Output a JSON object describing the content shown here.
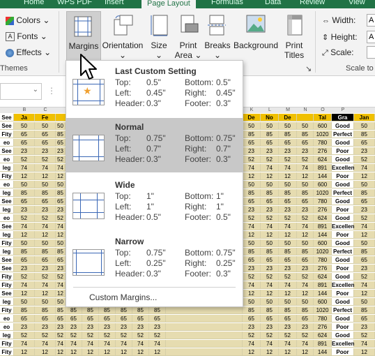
{
  "tabs": [
    "Home",
    "WPS PDF",
    "Insert",
    "Page Layout",
    "Formulas",
    "Data",
    "Review",
    "View"
  ],
  "ribbon": {
    "themes": {
      "colors": "Colors",
      "fonts": "Fonts",
      "effects": "Effects",
      "group_label": "Themes"
    },
    "margins": "Margins",
    "orientation": "Orientation",
    "size": "Size",
    "print_area_1": "Print",
    "print_area_2": "Area",
    "breaks": "Breaks",
    "background": "Background",
    "print_titles_1": "Print",
    "print_titles_2": "Titles",
    "width_label": "Width:",
    "height_label": "Height:",
    "scale_label": "Scale:",
    "width_value": "A",
    "height_value": "A",
    "scale_value": "",
    "scale_group_label": "Scale to"
  },
  "margins_menu": {
    "options": [
      {
        "title": "Last Custom Setting",
        "top": "0.5\"",
        "bottom": "0.5\"",
        "left": "0.45\"",
        "right": "0.45\"",
        "header": "0.3\"",
        "footer": "0.3\""
      },
      {
        "title": "Normal",
        "top": "0.75\"",
        "bottom": "0.75\"",
        "left": "0.7\"",
        "right": "0.7\"",
        "header": "0.3\"",
        "footer": "0.3\""
      },
      {
        "title": "Wide",
        "top": "1\"",
        "bottom": "1\"",
        "left": "1\"",
        "right": "1\"",
        "header": "0.5\"",
        "footer": "0.5\""
      },
      {
        "title": "Narrow",
        "top": "0.75\"",
        "bottom": "0.75\"",
        "left": "0.25\"",
        "right": "0.25\"",
        "header": "0.3\"",
        "footer": "0.3\""
      }
    ],
    "labels": {
      "top": "Top:",
      "bottom": "Bottom:",
      "left": "Left:",
      "right": "Right:",
      "header": "Header:",
      "footer": "Footer:"
    },
    "custom": "Custom Margins...",
    "selected_index": 1
  },
  "grid": {
    "col_headers": [
      "",
      "B",
      "C",
      "",
      "",
      "",
      "",
      "",
      "",
      "",
      "",
      "K",
      "L",
      "M",
      "N",
      "O",
      "P"
    ],
    "header_row": {
      "a": "See",
      "b": "Ja",
      "c": "Fe",
      "k": "De",
      "l": "No",
      "m": "De",
      "n": "Tal",
      "o": "Gra",
      "p": "Jan"
    },
    "rows": [
      {
        "a": "See",
        "b": "50",
        "c": "50",
        "v": "50",
        "n": "600",
        "g": "Good",
        "p": "50"
      },
      {
        "a": "Fity",
        "b": "65",
        "c": "65",
        "v": "85",
        "n": "1020",
        "g": "Perfect",
        "p": "85"
      },
      {
        "a": "eo",
        "b": "65",
        "c": "65",
        "v": "65",
        "n": "780",
        "g": "Good",
        "p": "65"
      },
      {
        "a": "See",
        "b": "23",
        "c": "23",
        "v": "23",
        "n": "276",
        "g": "Poor",
        "p": "23"
      },
      {
        "a": "eo",
        "b": "52",
        "c": "52",
        "v": "52",
        "n": "624",
        "g": "Good",
        "p": "52"
      },
      {
        "a": "leg",
        "b": "74",
        "c": "74",
        "v": "74",
        "n": "891",
        "g": "Excellent",
        "p": "74"
      },
      {
        "a": "Fity",
        "b": "12",
        "c": "12",
        "v": "12",
        "n": "144",
        "g": "Poor",
        "p": "12"
      },
      {
        "a": "eo",
        "b": "50",
        "c": "50",
        "v": "50",
        "n": "600",
        "g": "Good",
        "p": "50"
      },
      {
        "a": "leg",
        "b": "85",
        "c": "85",
        "v": "85",
        "n": "1020",
        "g": "Perfect",
        "p": "85"
      },
      {
        "a": "See",
        "b": "65",
        "c": "65",
        "v": "65",
        "n": "780",
        "g": "Good",
        "p": "65"
      },
      {
        "a": "leg",
        "b": "23",
        "c": "23",
        "v": "23",
        "n": "276",
        "g": "Poor",
        "p": "23"
      },
      {
        "a": "eo",
        "b": "52",
        "c": "52",
        "v": "52",
        "n": "624",
        "g": "Good",
        "p": "52"
      },
      {
        "a": "See",
        "b": "74",
        "c": "74",
        "v": "74",
        "n": "891",
        "g": "Excellent",
        "p": "74"
      },
      {
        "a": "leg",
        "b": "12",
        "c": "12",
        "v": "12",
        "n": "144",
        "g": "Poor",
        "p": "12"
      },
      {
        "a": "Fity",
        "b": "50",
        "c": "50",
        "v": "50",
        "n": "600",
        "g": "Good",
        "p": "50"
      },
      {
        "a": "leg",
        "b": "85",
        "c": "85",
        "v": "85",
        "n": "1020",
        "g": "Perfect",
        "p": "85"
      },
      {
        "a": "See",
        "b": "65",
        "c": "65",
        "v": "65",
        "n": "780",
        "g": "Good",
        "p": "65"
      },
      {
        "a": "See",
        "b": "23",
        "c": "23",
        "v": "23",
        "n": "276",
        "g": "Poor",
        "p": "23"
      },
      {
        "a": "Fity",
        "b": "52",
        "c": "52",
        "v": "52",
        "n": "624",
        "g": "Good",
        "p": "52"
      },
      {
        "a": "Fity",
        "b": "74",
        "c": "74",
        "v": "74",
        "n": "891",
        "g": "Excellent",
        "p": "74"
      },
      {
        "a": "See",
        "b": "12",
        "c": "12",
        "v": "12",
        "n": "144",
        "g": "Poor",
        "p": "12"
      },
      {
        "a": "leg",
        "b": "50",
        "c": "50",
        "v": "50",
        "n": "600",
        "g": "Good",
        "p": "50"
      },
      {
        "a": "Fity",
        "b": "85",
        "c": "85",
        "v": "85",
        "n": "1020",
        "g": "Perfect",
        "p": "85"
      },
      {
        "a": "eo",
        "b": "65",
        "c": "65",
        "v": "65",
        "n": "780",
        "g": "Good",
        "p": "65"
      },
      {
        "a": "eo",
        "b": "23",
        "c": "23",
        "v": "23",
        "n": "276",
        "g": "Poor",
        "p": "23"
      },
      {
        "a": "leg",
        "b": "52",
        "c": "52",
        "v": "52",
        "n": "624",
        "g": "Good",
        "p": "52"
      },
      {
        "a": "Fity",
        "b": "74",
        "c": "74",
        "v": "74",
        "n": "891",
        "g": "Excellent",
        "p": "74"
      },
      {
        "a": "Fity",
        "b": "12",
        "c": "12",
        "v": "12",
        "n": "144",
        "g": "Poor",
        "p": "12"
      }
    ]
  },
  "colors": {
    "accent": "#217346",
    "cell_fill": "#e6dcb0",
    "header_fill": "#f0c000",
    "grade_header": "#000000",
    "grade_fill": "#ffffff"
  }
}
